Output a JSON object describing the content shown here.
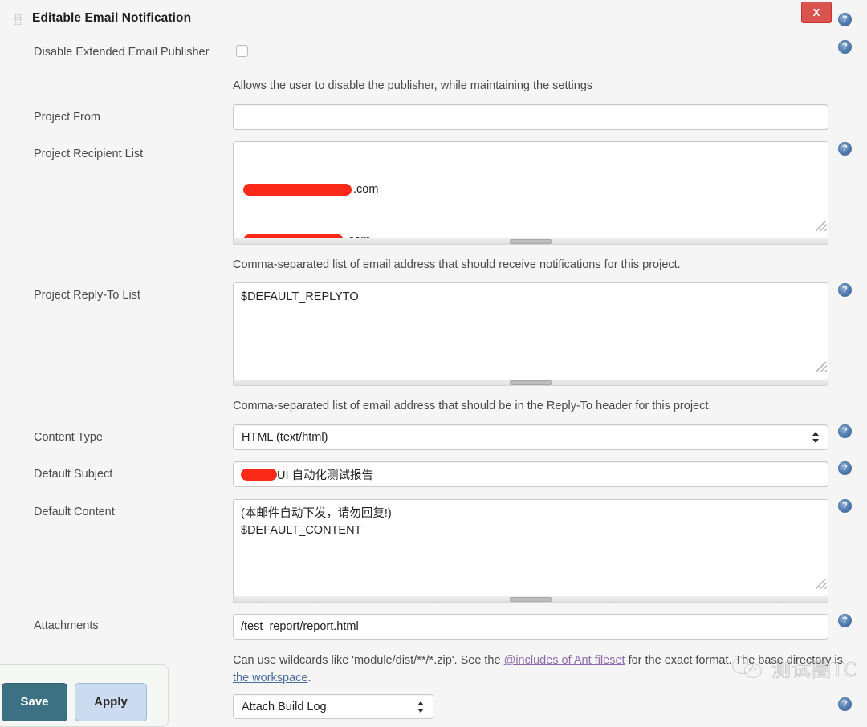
{
  "section": {
    "title": "Editable Email Notification",
    "close_label": "X",
    "drag_handle": "drag-handle-icon"
  },
  "help_icon_label": "?",
  "fields": {
    "disable_publisher": {
      "label": "Disable Extended Email Publisher",
      "checked": false,
      "description": "Allows the user to disable the publisher, while maintaining the settings"
    },
    "project_from": {
      "label": "Project From",
      "value": ""
    },
    "project_recipient_list": {
      "label": "Project Recipient List",
      "line1_suffix": ".com",
      "line2_suffix": ".com",
      "description": "Comma-separated list of email address that should receive notifications for this project."
    },
    "project_reply_to_list": {
      "label": "Project Reply-To List",
      "value": "$DEFAULT_REPLYTO",
      "description": "Comma-separated list of email address that should be in the Reply-To header for this project."
    },
    "content_type": {
      "label": "Content Type",
      "value": "HTML (text/html)"
    },
    "default_subject": {
      "label": "Default Subject",
      "value": "UI 自动化测试报告"
    },
    "default_content": {
      "label": "Default Content",
      "value": "(本邮件自动下发，请勿回复!)\n$DEFAULT_CONTENT"
    },
    "attachments": {
      "label": "Attachments",
      "value": "/test_report/report.html",
      "description_part1": "Can use wildcards like 'module/dist/**/*.zip'. See the ",
      "link_ant": "@includes of Ant fileset",
      "description_part2": " for the exact format. The base directory is ",
      "link_workspace": "the workspace",
      "description_part3": "."
    },
    "attach_build_log": {
      "value": "Attach Build Log"
    }
  },
  "buttons": {
    "save": "Save",
    "apply": "Apply"
  },
  "watermark": {
    "text": "测试圈TC"
  },
  "colors": {
    "close_red": "#d9534f",
    "redaction": "#fa2a18",
    "save_teal": "#3b7183",
    "apply_blue": "#ccdcf0",
    "help_blue": "#5580b4",
    "link_blue": "#4a6f9c",
    "link_visited": "#8f6aa8"
  }
}
